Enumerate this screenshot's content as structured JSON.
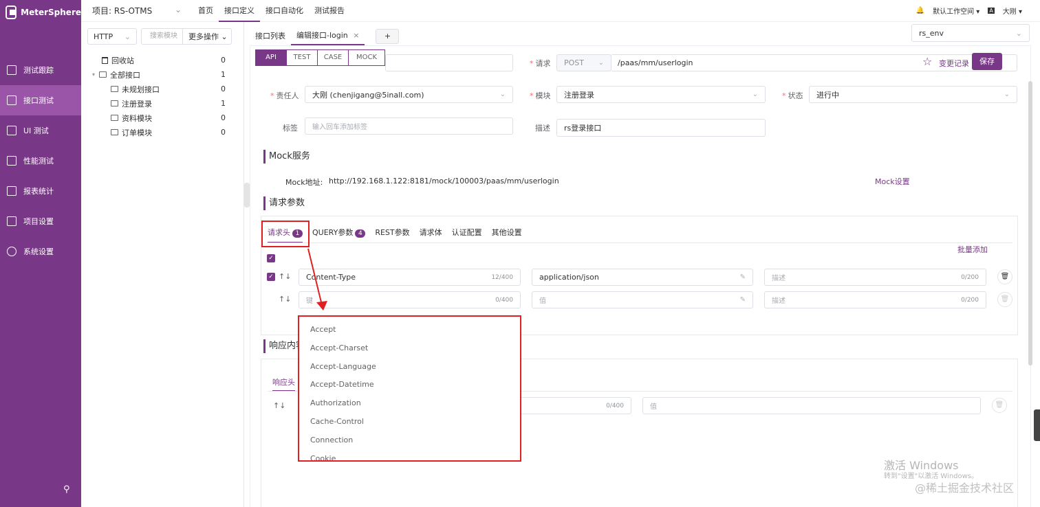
{
  "app": {
    "name": "MeterSphere"
  },
  "sidebar": {
    "items": [
      {
        "label": "测试跟踪",
        "icon": "clipboard-icon",
        "active": false
      },
      {
        "label": "接口测试",
        "icon": "api-icon",
        "active": true
      },
      {
        "label": "UI 测试",
        "icon": "ui-icon",
        "active": false
      },
      {
        "label": "性能测试",
        "icon": "chart-icon",
        "active": false
      },
      {
        "label": "报表统计",
        "icon": "report-icon",
        "active": false
      },
      {
        "label": "项目设置",
        "icon": "folder-icon",
        "active": false
      },
      {
        "label": "系统设置",
        "icon": "gear-icon",
        "active": false
      }
    ]
  },
  "topbar": {
    "project": "项目: RS-OTMS",
    "menu": [
      "首页",
      "接口定义",
      "接口自动化",
      "测试报告"
    ],
    "active_menu": 1,
    "workspace": "默认工作空间",
    "language": "A",
    "user": "大刚"
  },
  "tree": {
    "protocol": "HTTP",
    "search_placeholder": "搜索模块",
    "more": "更多操作",
    "recycle": {
      "label": "回收站",
      "count": "0"
    },
    "root": {
      "label": "全部接口",
      "count": "1"
    },
    "children": [
      {
        "label": "未规划接口",
        "count": "0"
      },
      {
        "label": "注册登录",
        "count": "1"
      },
      {
        "label": "资料模块",
        "count": "0"
      },
      {
        "label": "订单模块",
        "count": "0"
      }
    ]
  },
  "main_tabs": {
    "list": "接口列表",
    "edit": "编辑接口-login",
    "add": "+"
  },
  "env": "rs_env",
  "modes": [
    "API",
    "TEST",
    "CASE",
    "MOCK"
  ],
  "form": {
    "request_label": "请求",
    "method": "POST",
    "path": "/paas/mm/userlogin",
    "change_log": "变更记录",
    "save": "保存",
    "owner_label": "责任人",
    "owner": "大刚 (chenjigang@5inall.com)",
    "module_label": "模块",
    "module": "注册登录",
    "status_label": "状态",
    "status": "进行中",
    "tags_label": "标签",
    "tags_placeholder": "输入回车添加标签",
    "desc_label": "描述",
    "desc": "rs登录接口"
  },
  "mock": {
    "title": "Mock服务",
    "addr_label": "Mock地址:",
    "addr": "http://192.168.1.122:8181/mock/100003/paas/mm/userlogin",
    "settings": "Mock设置"
  },
  "params": {
    "title": "请求参数",
    "tabs": [
      {
        "label": "请求头",
        "badge": "1"
      },
      {
        "label": "QUERY参数",
        "badge": "4"
      },
      {
        "label": "REST参数"
      },
      {
        "label": "请求体"
      },
      {
        "label": "认证配置"
      },
      {
        "label": "其他设置"
      }
    ],
    "batch_add": "批量添加",
    "rows": [
      {
        "key": "Content-Type",
        "key_count": "12/400",
        "value": "application/json",
        "desc_ph": "描述",
        "desc_count": "0/200"
      },
      {
        "key_ph": "键",
        "key_count": "0/400",
        "value_ph": "值",
        "desc_ph": "描述",
        "desc_count": "0/200"
      }
    ]
  },
  "response": {
    "title": "响应内容",
    "tab": "响应头",
    "row": {
      "key_count": "0/400",
      "value_ph": "值"
    }
  },
  "dropdown": {
    "options": [
      "Accept",
      "Accept-Charset",
      "Accept-Language",
      "Accept-Datetime",
      "Authorization",
      "Cache-Control",
      "Connection",
      "Cookie"
    ]
  },
  "watermarks": {
    "win_title": "激活 Windows",
    "win_sub": "转到\"设置\"以激活 Windows。",
    "site": "@稀土掘金技术社区"
  },
  "colors": {
    "brand": "#783887",
    "highlight": "#e02020"
  }
}
